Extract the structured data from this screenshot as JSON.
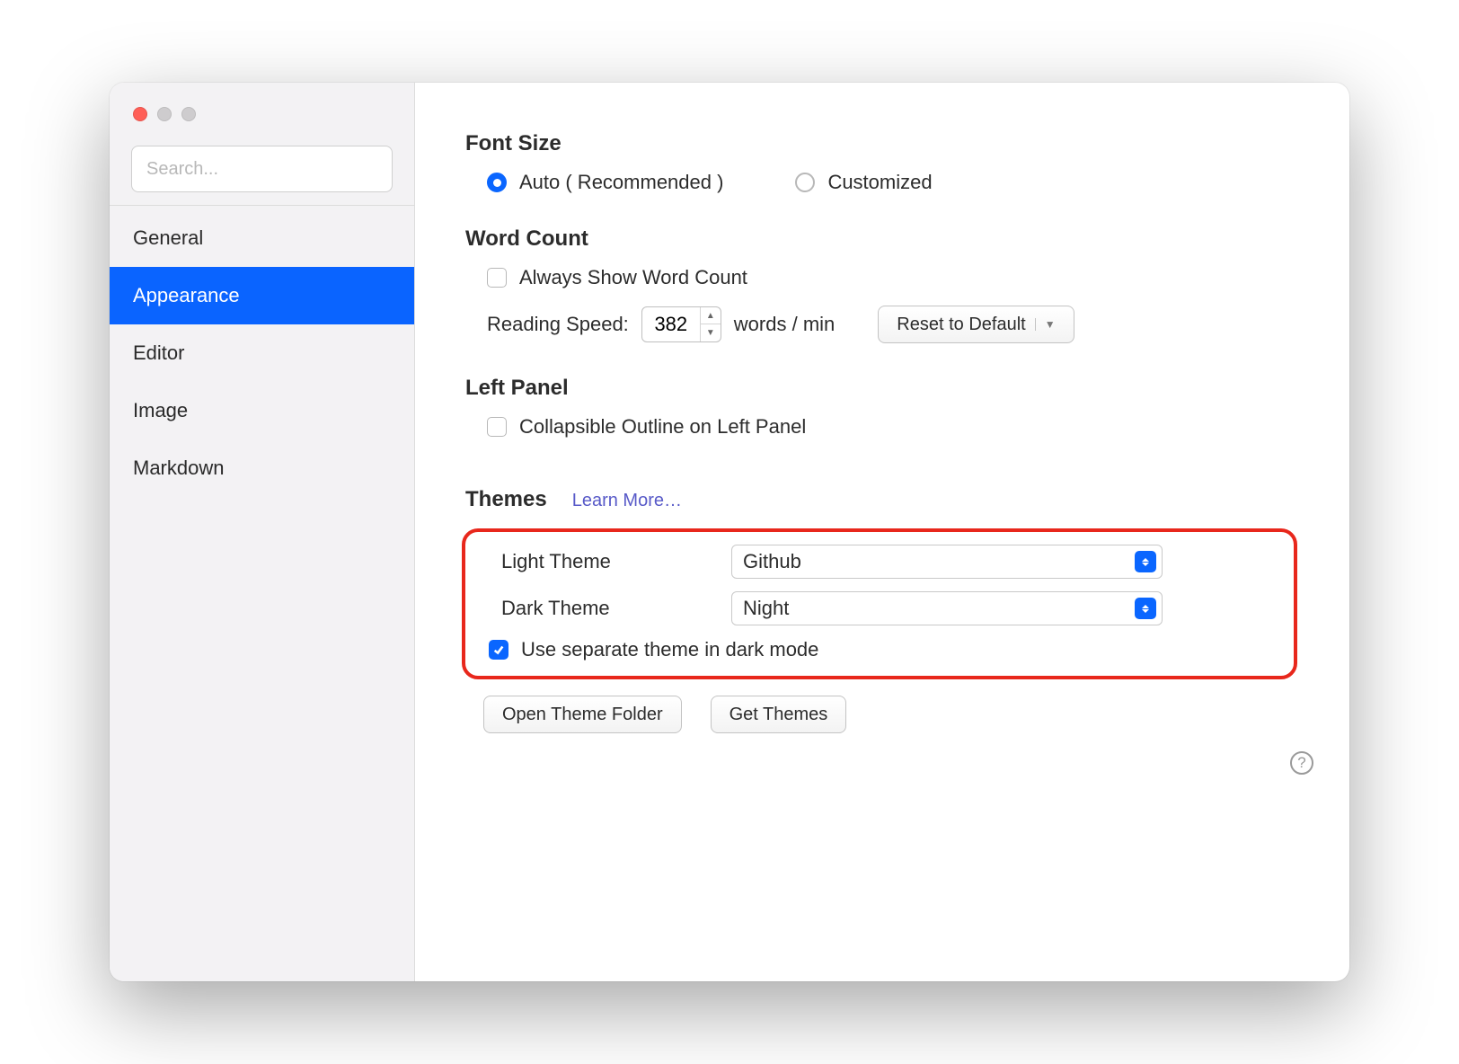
{
  "search": {
    "placeholder": "Search..."
  },
  "sidebar": {
    "items": [
      {
        "label": "General"
      },
      {
        "label": "Appearance"
      },
      {
        "label": "Editor"
      },
      {
        "label": "Image"
      },
      {
        "label": "Markdown"
      }
    ],
    "active_index": 1
  },
  "fontSize": {
    "title": "Font Size",
    "auto_label": "Auto ( Recommended )",
    "customized_label": "Customized",
    "selected": "auto"
  },
  "wordCount": {
    "title": "Word Count",
    "always_show_label": "Always Show Word Count",
    "always_show_checked": false,
    "reading_speed_label": "Reading Speed:",
    "reading_speed_value": "382",
    "reading_speed_unit": "words / min",
    "reset_label": "Reset to Default"
  },
  "leftPanel": {
    "title": "Left Panel",
    "collapsible_label": "Collapsible Outline on Left Panel",
    "collapsible_checked": false
  },
  "themes": {
    "title": "Themes",
    "learn_more_label": "Learn More…",
    "light_label": "Light Theme",
    "light_value": "Github",
    "dark_label": "Dark Theme",
    "dark_value": "Night",
    "separate_label": "Use separate theme in dark mode",
    "separate_checked": true,
    "open_folder_label": "Open Theme Folder",
    "get_themes_label": "Get Themes"
  }
}
